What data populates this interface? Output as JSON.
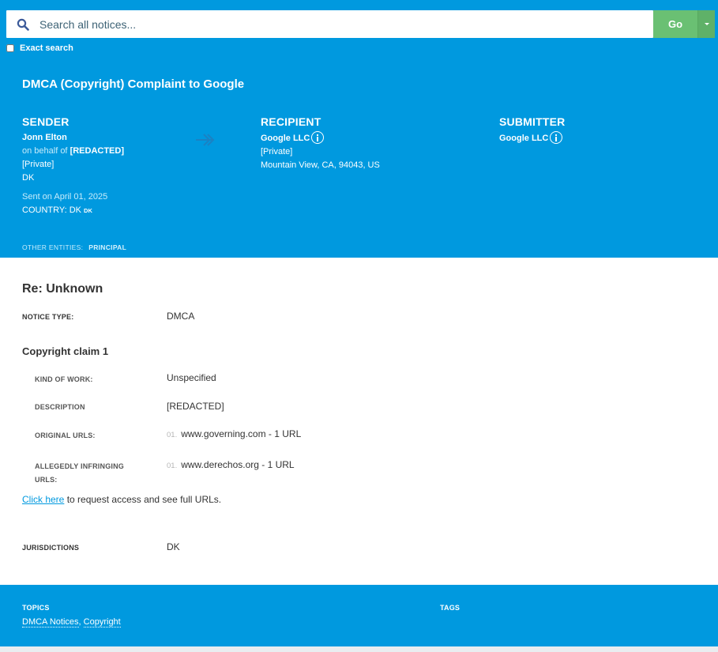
{
  "search": {
    "placeholder": "Search all notices...",
    "go_label": "Go",
    "exact_label": "Exact search"
  },
  "notice": {
    "title": "DMCA (Copyright) Complaint to Google"
  },
  "sender": {
    "heading": "SENDER",
    "name": "Jonn Elton",
    "on_behalf_prefix": "on behalf of",
    "on_behalf_name": "[REDACTED]",
    "private": "[Private]",
    "location": "DK",
    "sent_on": "Sent on April 01, 2025",
    "country_label": "COUNTRY: DK",
    "country_code": "DK"
  },
  "recipient": {
    "heading": "RECIPIENT",
    "name": "Google LLC",
    "private": "[Private]",
    "address": "Mountain View, CA, 94043, US"
  },
  "submitter": {
    "heading": "SUBMITTER",
    "name": "Google LLC"
  },
  "other_entities": {
    "label": "OTHER ENTITIES:",
    "principal": "PRINCIPAL"
  },
  "main": {
    "re_title": "Re: Unknown",
    "notice_type_label": "NOTICE TYPE:",
    "notice_type_value": "DMCA",
    "claim_title": "Copyright claim 1",
    "kind_label": "KIND OF WORK:",
    "kind_value": "Unspecified",
    "description_label": "DESCRIPTION",
    "description_value": "[REDACTED]",
    "original_urls_label": "ORIGINAL URLS:",
    "original_url_num": "01.",
    "original_url": "www.governing.com - 1 URL",
    "infringing_label_line1": "ALLEGEDLY INFRINGING",
    "infringing_label_line2": "URLS:",
    "infringing_url_num": "01.",
    "infringing_url": "www.derechos.org - 1 URL",
    "request_link": "Click here",
    "request_text": " to request access and see full URLs.",
    "jurisdictions_label": "JURISDICTIONS",
    "jurisdictions_value": "DK"
  },
  "footer": {
    "topics_label": "TOPICS",
    "topic_1": "DMCA Notices",
    "topic_2": "Copyright",
    "tags_label": "TAGS"
  }
}
